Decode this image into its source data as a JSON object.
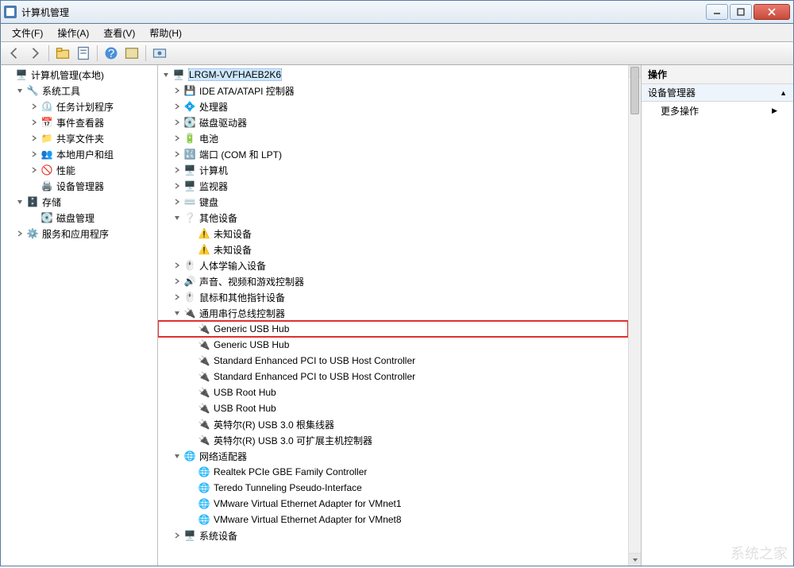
{
  "window": {
    "title": "计算机管理",
    "buttons": {
      "min": "–",
      "max": "☐",
      "close": "×"
    }
  },
  "menu": {
    "file": "文件(F)",
    "action": "操作(A)",
    "view": "查看(V)",
    "help": "帮助(H)"
  },
  "toolbar": {
    "back": "back-icon",
    "forward": "forward-icon",
    "up": "folder-up-icon",
    "props": "properties-icon",
    "help": "help-icon",
    "btn6": "toolbar-icon",
    "btn7": "toolbar-icon"
  },
  "left_tree": {
    "root": "计算机管理(本地)",
    "system_tools": {
      "label": "系统工具",
      "task_scheduler": "任务计划程序",
      "event_viewer": "事件查看器",
      "shared_folders": "共享文件夹",
      "local_users": "本地用户和组",
      "performance": "性能",
      "device_manager": "设备管理器"
    },
    "storage": {
      "label": "存储",
      "disk_mgmt": "磁盘管理"
    },
    "services": "服务和应用程序"
  },
  "center_tree": {
    "root": "LRGM-VVFHAEB2K6",
    "items": [
      {
        "label": "IDE ATA/ATAPI 控制器",
        "expandable": true
      },
      {
        "label": "处理器",
        "expandable": true
      },
      {
        "label": "磁盘驱动器",
        "expandable": true
      },
      {
        "label": "电池",
        "expandable": true
      },
      {
        "label": "端口 (COM 和 LPT)",
        "expandable": true
      },
      {
        "label": "计算机",
        "expandable": true
      },
      {
        "label": "监视器",
        "expandable": true
      },
      {
        "label": "键盘",
        "expandable": true
      },
      {
        "label": "其他设备",
        "expandable": true,
        "expanded": true,
        "children": [
          {
            "label": "未知设备",
            "warn": true
          },
          {
            "label": "未知设备",
            "warn": true
          }
        ]
      },
      {
        "label": "人体学输入设备",
        "expandable": true
      },
      {
        "label": "声音、视频和游戏控制器",
        "expandable": true
      },
      {
        "label": "鼠标和其他指针设备",
        "expandable": true
      },
      {
        "label": "通用串行总线控制器",
        "expandable": true,
        "expanded": true,
        "children": [
          {
            "label": "Generic USB Hub",
            "highlight": true
          },
          {
            "label": "Generic USB Hub"
          },
          {
            "label": "Standard Enhanced PCI to USB Host Controller"
          },
          {
            "label": "Standard Enhanced PCI to USB Host Controller"
          },
          {
            "label": "USB Root Hub"
          },
          {
            "label": "USB Root Hub"
          },
          {
            "label": "英特尔(R) USB 3.0 根集线器"
          },
          {
            "label": "英特尔(R) USB 3.0 可扩展主机控制器"
          }
        ]
      },
      {
        "label": "网络适配器",
        "expandable": true,
        "expanded": true,
        "children": [
          {
            "label": "Realtek PCIe GBE Family Controller"
          },
          {
            "label": "Teredo Tunneling Pseudo-Interface"
          },
          {
            "label": "VMware Virtual Ethernet Adapter for VMnet1"
          },
          {
            "label": "VMware Virtual Ethernet Adapter for VMnet8"
          }
        ]
      },
      {
        "label": "系统设备",
        "expandable": true
      }
    ]
  },
  "right_pane": {
    "header": "操作",
    "section": "设备管理器",
    "more": "更多操作"
  }
}
